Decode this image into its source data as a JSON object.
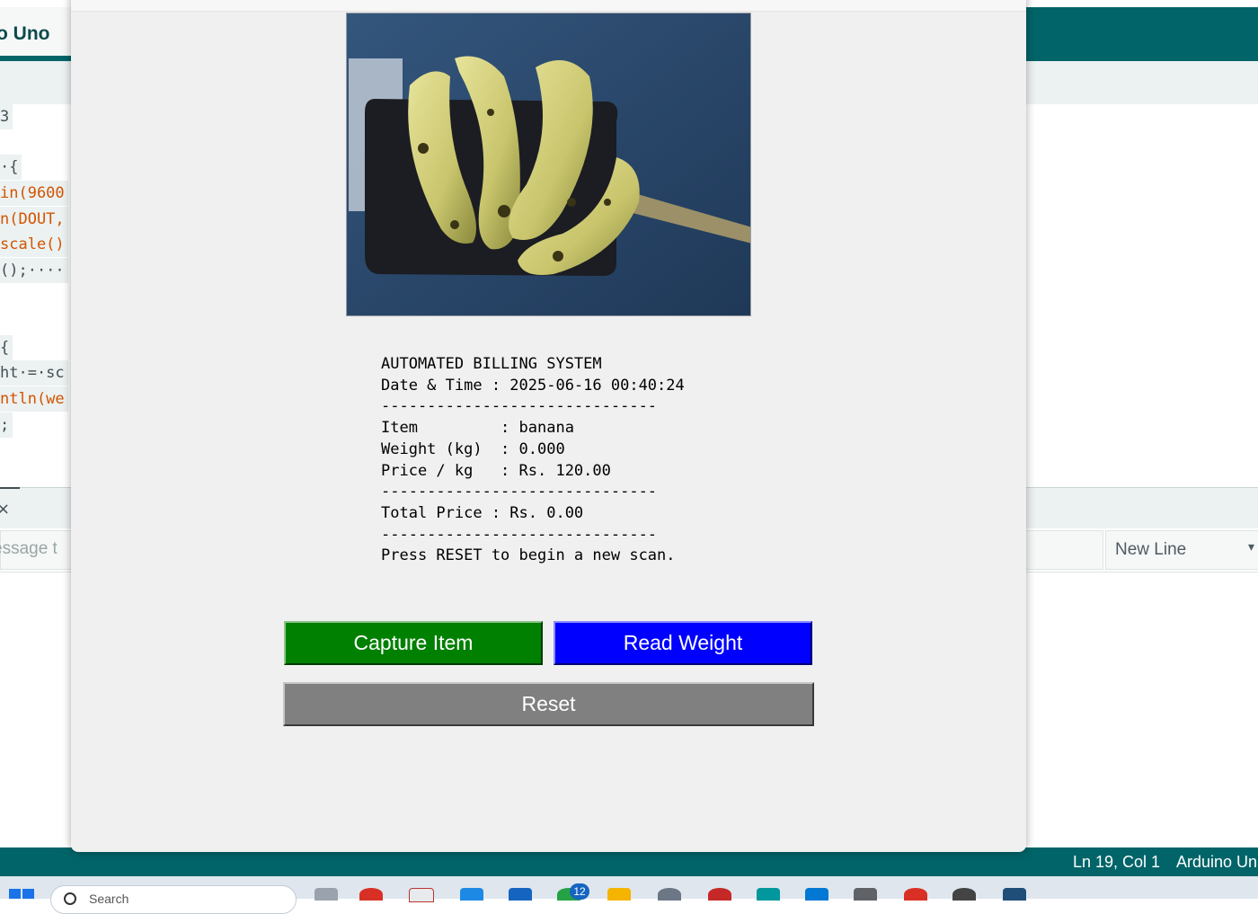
{
  "ide": {
    "tab_label": "o Uno",
    "code_lines": [
      {
        "text": "3"
      },
      {
        "text": "·{"
      },
      {
        "text": "in(9600"
      },
      {
        "text": "n(DOUT,"
      },
      {
        "text": "scale()"
      },
      {
        "text": "();····"
      },
      {
        "text": "{"
      },
      {
        "text": "ht·=·sc"
      },
      {
        "text": "ntln(we"
      },
      {
        "text": ";"
      }
    ],
    "serial": {
      "close_icon": "×",
      "message_placeholder": "essage t",
      "line_ending": "New Line",
      "caret": "▾"
    },
    "status": {
      "position": "Ln 19, Col 1",
      "board": "Arduino Un"
    }
  },
  "taskbar": {
    "search_text": "Search",
    "badge_count": "12"
  },
  "dialog": {
    "receipt": {
      "title": "AUTOMATED BILLING SYSTEM",
      "datetime_line": "Date & Time : 2025-06-16 00:40:24",
      "separator": "------------------------------",
      "item_line": "Item         : banana",
      "weight_line": "Weight (kg)  : 0.000",
      "price_line": "Price / kg   : Rs. 120.00",
      "total_line": "Total Price : Rs. 0.00",
      "footer_line": "Press RESET to begin a new scan."
    },
    "buttons": {
      "capture": "Capture Item",
      "read_weight": "Read Weight",
      "reset": "Reset"
    },
    "colors": {
      "capture": "#008000",
      "read_weight": "#0000ff",
      "reset": "#808080"
    }
  }
}
